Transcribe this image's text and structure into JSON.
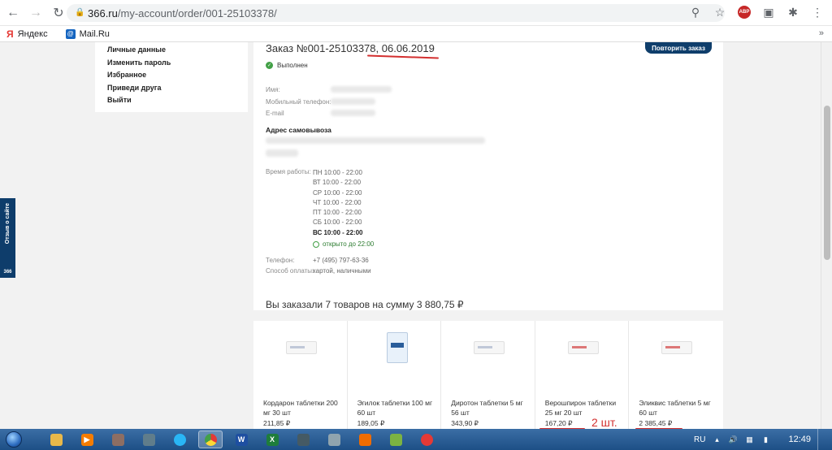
{
  "browser": {
    "back_icon": "back-arrow-icon",
    "url_host": "366.ru",
    "url_path": "/my-account/order/001-25103378/",
    "bookmarks": [
      {
        "label": "Яндекс",
        "icon": "yandex-icon"
      },
      {
        "label": "Mail.Ru",
        "icon": "mailru-icon"
      }
    ],
    "abp_label": "ABP"
  },
  "sidebar": {
    "items": [
      "Личные данные",
      "Изменить пароль",
      "Избранное",
      "Приведи друга",
      "Выйти"
    ]
  },
  "order": {
    "title_prefix": "Заказ №001-25103378, ",
    "date": "06.06.2019",
    "repeat_button": "Повторить заказ",
    "status": "Выполнен",
    "labels": {
      "name": "Имя:",
      "phone": "Мобильный телефон:",
      "email": "E-mail",
      "pickup": "Адрес самовывоза",
      "hours": "Время работы:",
      "store_phone": "Телефон:",
      "payment": "Способ оплаты:"
    },
    "hours": [
      "ПН 10:00 - 22:00",
      "ВТ 10:00 - 22:00",
      "СР 10:00 - 22:00",
      "ЧТ 10:00 - 22:00",
      "ПТ 10:00 - 22:00",
      "СБ 10:00 - 22:00",
      "ВС 10:00 - 22:00"
    ],
    "open_now": "открыто до 22:00",
    "store_phone": "+7 (495) 797-63-36",
    "payment": "картой, наличными"
  },
  "summary": "Вы заказали 7 товаров на сумму 3 880,75 ₽",
  "products": [
    {
      "name": "Кордарон таблетки 200 мг 30 шт",
      "price": "211,85 ₽"
    },
    {
      "name": "Эгилок таблетки 100 мг 60 шт",
      "price": "189,05 ₽"
    },
    {
      "name": "Диротон таблетки 5 мг 56 шт",
      "price": "343,90 ₽"
    },
    {
      "name": "Верошпирон таблетки 25 мг 20 шт",
      "price": "167,20 ₽"
    },
    {
      "name": "Эликвис таблетки 5 мг 60 шт",
      "price": "2 385,45 ₽"
    }
  ],
  "annotation": "2 шт.",
  "feedback_tab": {
    "label": "Отзыв о сайте",
    "logo": "366"
  },
  "taskbar": {
    "lang": "RU",
    "time": "12:49"
  }
}
